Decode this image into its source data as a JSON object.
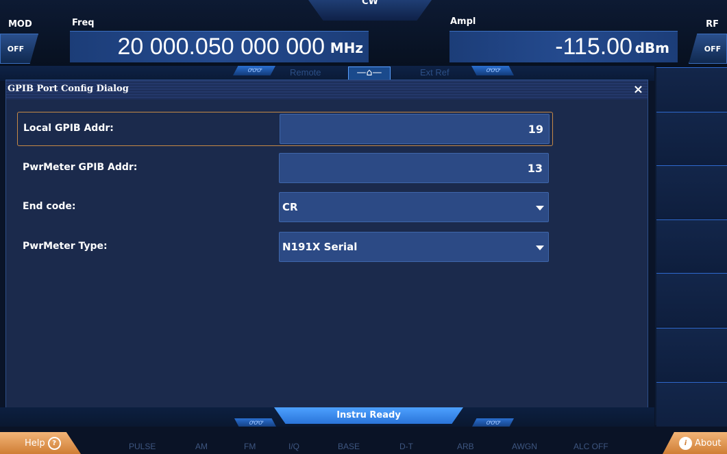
{
  "header": {
    "mod_label": "MOD",
    "mod_state": "OFF",
    "rf_label": "RF",
    "rf_state": "OFF",
    "mode": "CW",
    "freq_label": "Freq",
    "freq_value": "20 000.050 000 000",
    "freq_unit": "MHz",
    "ampl_label": "Ampl",
    "ampl_value": "-115.00",
    "ampl_unit": "dBm"
  },
  "status_strip": {
    "remote": "Remote",
    "ext_ref": "Ext Ref",
    "home_icon": "home-icon",
    "home_glyph": "—⌂—",
    "deco_left": "ꝍꝍꝍ",
    "deco_right": "ꝍꝍꝍ"
  },
  "dialog": {
    "title": "GPIB Port Config Dialog",
    "close_glyph": "×",
    "fields": [
      {
        "label": "Local GPIB Addr:",
        "value": "19"
      },
      {
        "label": "PwrMeter GPIB Addr:",
        "value": "13"
      },
      {
        "label": "End code:",
        "value": "CR"
      },
      {
        "label": "PwrMeter Type:",
        "value": "N191X Serial"
      }
    ]
  },
  "bottom_status": {
    "ready_text": "Instru Ready",
    "deco_left": "ꝍꝍꝍ",
    "deco_right": "ꝍꝍꝍ"
  },
  "footer": {
    "help_label": "Help",
    "help_glyph": "?",
    "about_label": "About",
    "about_glyph": "i",
    "items": [
      "PULSE",
      "AM",
      "FM",
      "I/Q",
      "BASE",
      "D-T",
      "ARB",
      "AWGN",
      "ALC OFF"
    ]
  },
  "colors": {
    "background": "#0a1428",
    "accent": "#4da1ff",
    "selected_border": "#c88a46",
    "help_button": "#e09a55"
  }
}
